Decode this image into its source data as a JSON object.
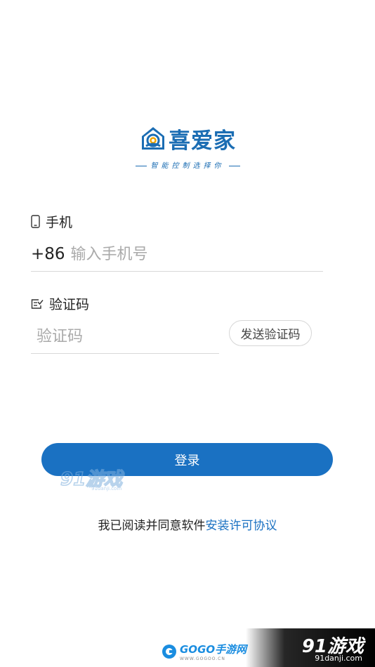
{
  "app": {
    "logo_text": "喜爱家",
    "slogan": "智能控制选择你"
  },
  "phone": {
    "label": "手机",
    "prefix": "+86",
    "placeholder": "输入手机号",
    "value": ""
  },
  "code": {
    "label": "验证码",
    "placeholder": "验证码",
    "value": "",
    "send_label": "发送验证码"
  },
  "login": {
    "label": "登录"
  },
  "agreement": {
    "text": "我已阅读并同意软件",
    "link": "安装许可协议"
  },
  "watermarks": {
    "center_brand": "91游戏",
    "center_url": "91danji.com",
    "bottom_brand": "GOGO手游网",
    "bottom_url": "WWW.GOGOO.CN",
    "corner_brand": "91游戏",
    "corner_url": "91danji.com"
  },
  "colors": {
    "accent": "#1a71c2",
    "logo": "#1b6db3"
  }
}
